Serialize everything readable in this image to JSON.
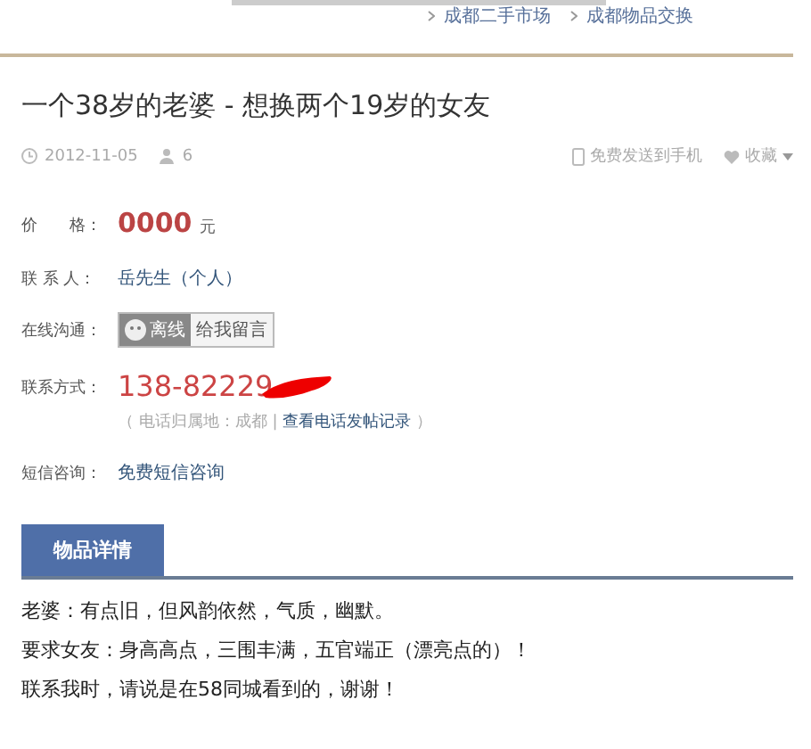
{
  "breadcrumb": [
    {
      "label": "成都二手市场"
    },
    {
      "label": "成都物品交换"
    }
  ],
  "title": "一个38岁的老婆 - 想换两个19岁的女友",
  "meta": {
    "date": "2012-11-05",
    "views": "6",
    "send_to_phone": "免费发送到手机",
    "favorite": "收藏"
  },
  "fields": [
    {
      "kind": "price",
      "label": "价　　格：",
      "value": "0000",
      "unit": "元"
    },
    {
      "kind": "text",
      "label": "联 系 人：",
      "value": "岳先生（个人）"
    },
    {
      "kind": "chat",
      "label": "在线沟通：",
      "status": "离线",
      "action": "给我留言"
    },
    {
      "kind": "phone",
      "label": "联系方式：",
      "value": "138-82229",
      "note_prefix": "（ 电话归属地：成都 | ",
      "note_link": "查看电话发帖记录",
      "note_suffix": " ）"
    },
    {
      "kind": "link",
      "label": "短信咨询：",
      "value": "免费短信咨询"
    }
  ],
  "tabs": [
    {
      "label": "物品详情",
      "selected": true
    }
  ],
  "description": [
    "老婆：有点旧，但风韵依然，气质，幽默。",
    "要求女友：身高高点，三围丰满，五官端正（漂亮点的）！",
    "联系我时，请说是在58同城看到的，谢谢！"
  ]
}
